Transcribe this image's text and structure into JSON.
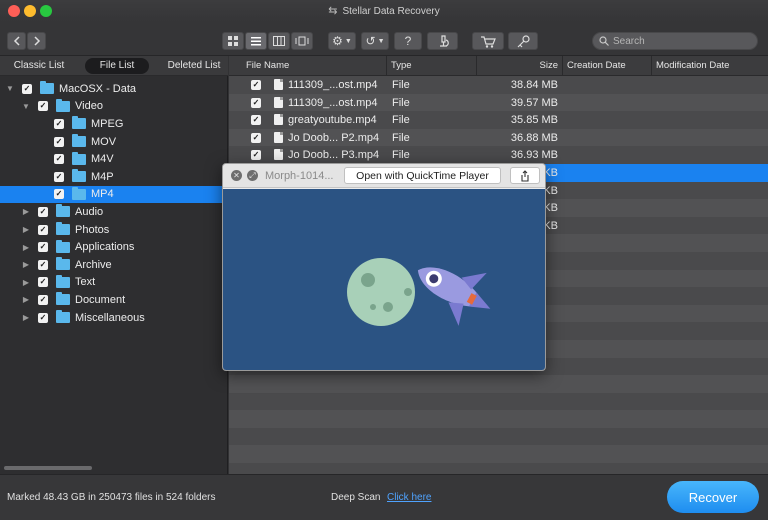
{
  "window": {
    "title": "Stellar Data Recovery"
  },
  "toolbar": {
    "back_icon": "chevron-left-icon",
    "forward_icon": "chevron-right-icon",
    "views": [
      "grid-view-icon",
      "list-view-icon",
      "column-view-icon",
      "coverflow-view-icon"
    ],
    "settings_icon": "gear-icon",
    "history_icon": "history-icon",
    "help_label": "?",
    "analyze_icon": "microscope-icon",
    "cart_icon": "cart-icon",
    "key_icon": "key-icon",
    "search_placeholder": "Search"
  },
  "left": {
    "tabs": [
      "Classic List",
      "File List",
      "Deleted List"
    ],
    "selected_tab": "File List",
    "tree": [
      {
        "label": "MacOSX - Data",
        "level": 0,
        "expanded": true,
        "checked": true
      },
      {
        "label": "Video",
        "level": 1,
        "expanded": true,
        "checked": true
      },
      {
        "label": "MPEG",
        "level": 2,
        "checked": true
      },
      {
        "label": "MOV",
        "level": 2,
        "checked": true
      },
      {
        "label": "M4V",
        "level": 2,
        "checked": true
      },
      {
        "label": "M4P",
        "level": 2,
        "checked": true
      },
      {
        "label": "MP4",
        "level": 2,
        "checked": true,
        "selected": true
      },
      {
        "label": "Audio",
        "level": 1,
        "expanded": false,
        "checked": true
      },
      {
        "label": "Photos",
        "level": 1,
        "expanded": false,
        "checked": true
      },
      {
        "label": "Applications",
        "level": 1,
        "expanded": false,
        "checked": true
      },
      {
        "label": "Archive",
        "level": 1,
        "expanded": false,
        "checked": true
      },
      {
        "label": "Text",
        "level": 1,
        "expanded": false,
        "checked": true
      },
      {
        "label": "Document",
        "level": 1,
        "expanded": false,
        "checked": true
      },
      {
        "label": "Miscellaneous",
        "level": 1,
        "expanded": false,
        "checked": true
      }
    ]
  },
  "table": {
    "columns": [
      "File Name",
      "Type",
      "Size",
      "Creation Date",
      "Modification Date"
    ],
    "rows": [
      {
        "name": "111309_...ost.mp4",
        "type": "File",
        "size": "38.84 MB"
      },
      {
        "name": "111309_...ost.mp4",
        "type": "File",
        "size": "39.57 MB"
      },
      {
        "name": "greatyoutube.mp4",
        "type": "File",
        "size": "35.85 MB"
      },
      {
        "name": "Jo Doob... P2.mp4",
        "type": "File",
        "size": "36.88 MB"
      },
      {
        "name": "Jo Doob... P3.mp4",
        "type": "File",
        "size": "36.93 MB"
      },
      {
        "name": "",
        "type": "",
        "size": "KB",
        "selected": true
      },
      {
        "name": "",
        "type": "",
        "size": "KB"
      },
      {
        "name": "",
        "type": "",
        "size": "KB"
      },
      {
        "name": "",
        "type": "",
        "size": "KB"
      }
    ]
  },
  "quicklook": {
    "file_name": "Morph-1014...",
    "open_label": "Open with QuickTime Player",
    "close_icon": "close-icon",
    "fullscreen_icon": "fullscreen-icon",
    "share_icon": "share-icon",
    "preview_image": "rocket-planet-illustration",
    "colors": {
      "background": "#2b5383",
      "planet": "#a8d0b8",
      "rocket": "#9a9ae0"
    }
  },
  "status": {
    "marked_text": "Marked 48.43 GB in 250473 files in 524 folders",
    "deep_scan_label": "Deep Scan",
    "deep_scan_link": "Click here",
    "recover_label": "Recover"
  },
  "colors": {
    "accent": "#1a82f0",
    "folder": "#5ab8ec",
    "link": "#4fa3ff"
  }
}
